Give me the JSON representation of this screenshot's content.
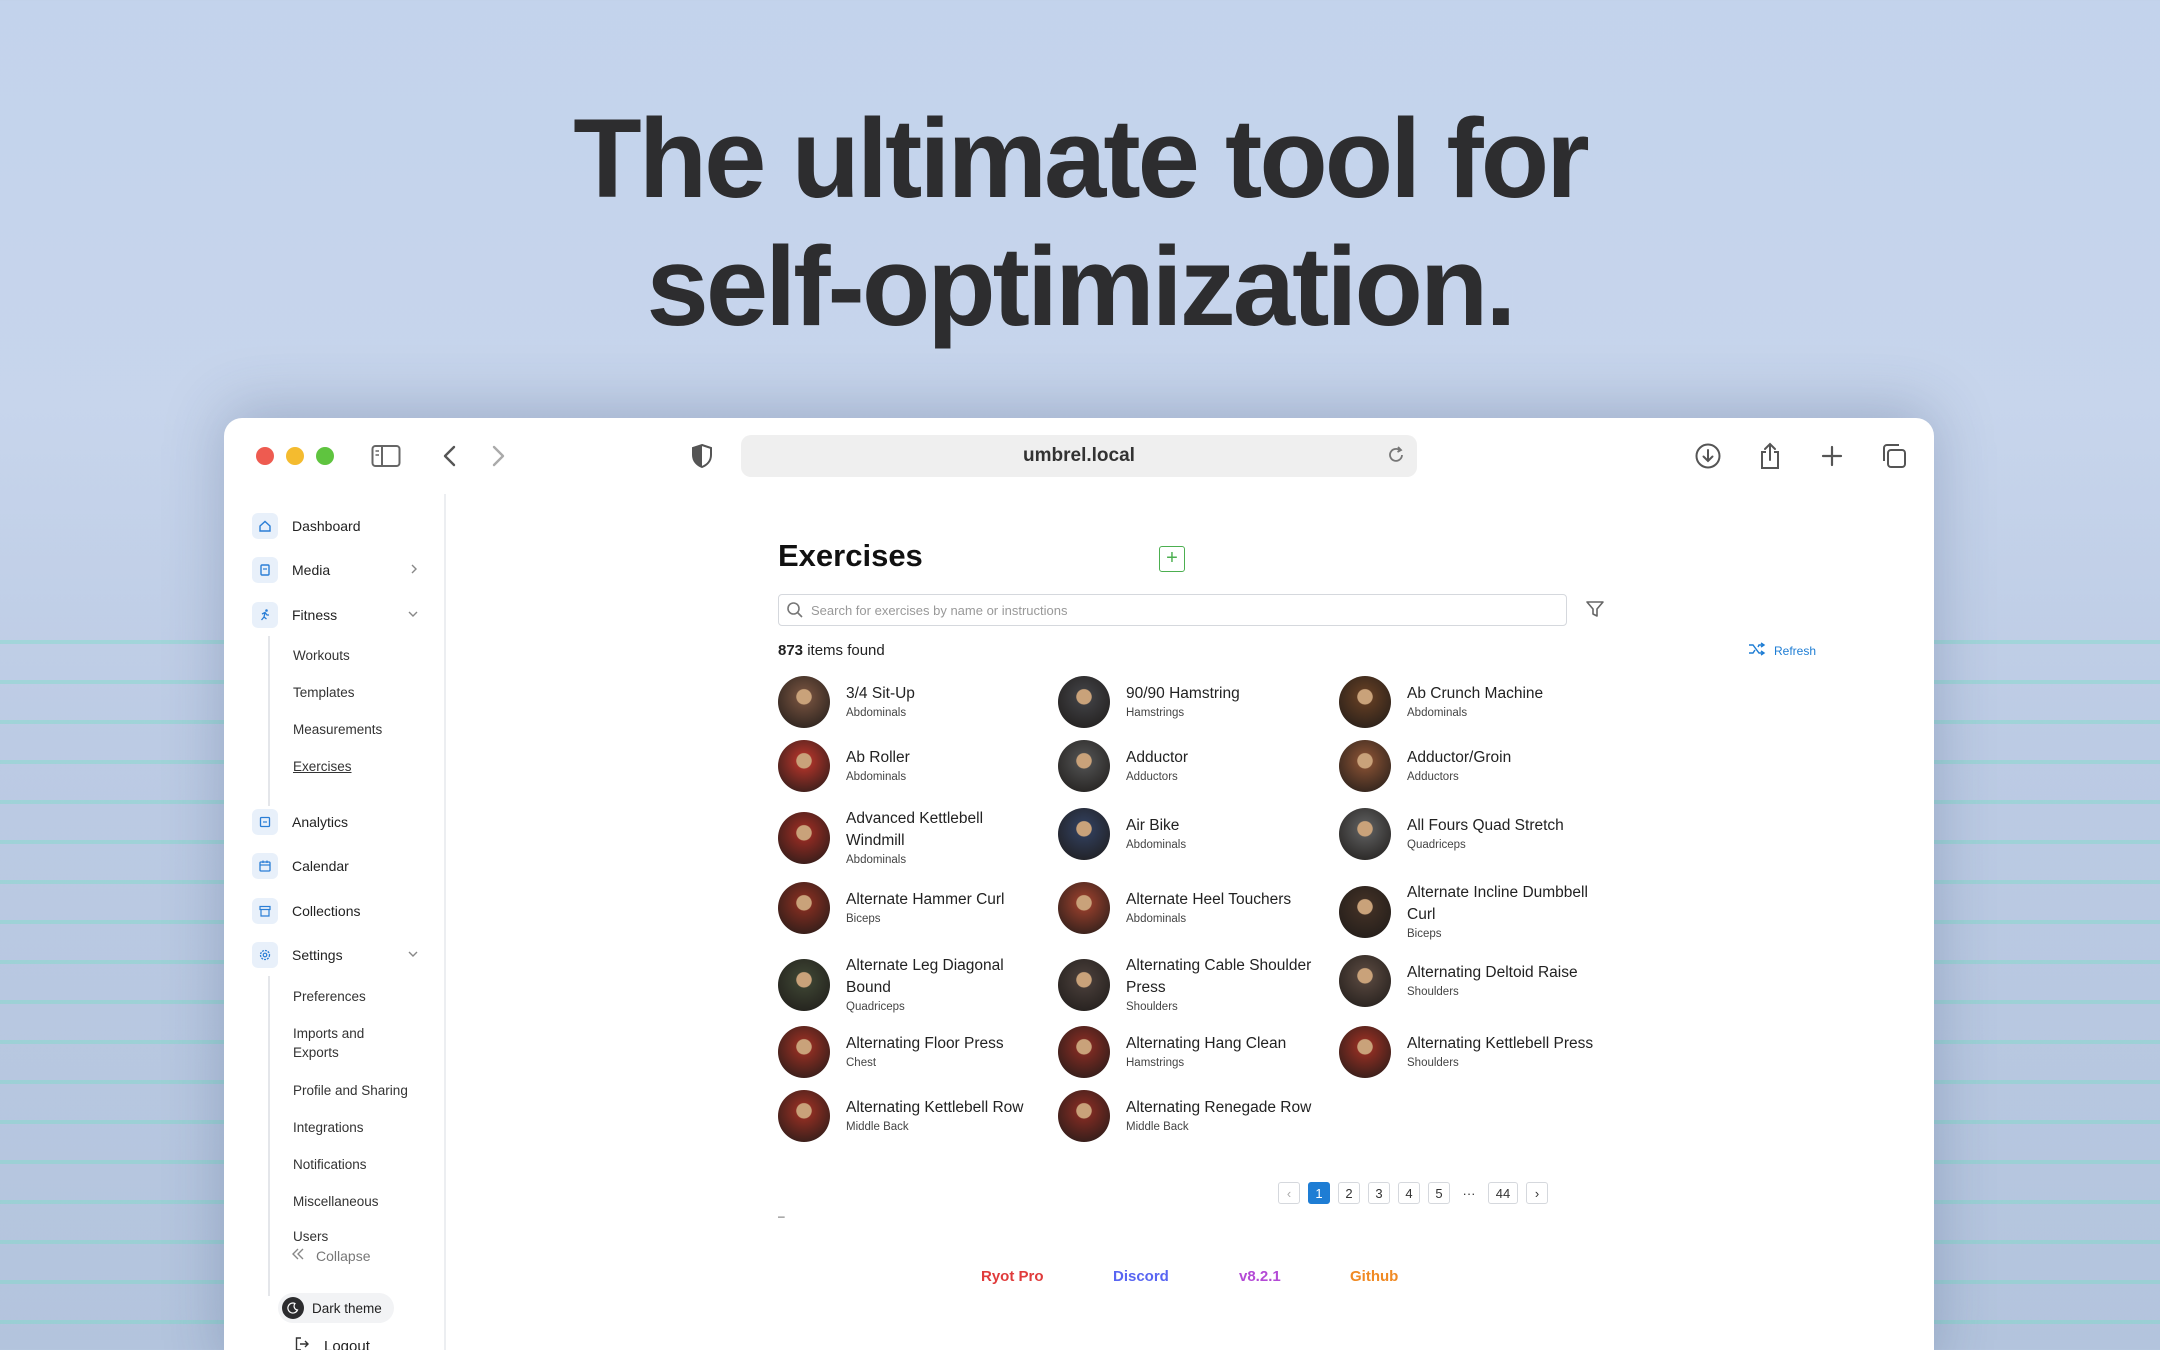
{
  "hero": {
    "line1": "The ultimate tool for",
    "line2": "self-optimization."
  },
  "browser": {
    "url": "umbrel.local",
    "icons": [
      "sidebar-toggle-icon",
      "back-icon",
      "forward-icon",
      "shield-icon",
      "reload-icon",
      "download-icon",
      "share-icon",
      "new-tab-icon",
      "tabs-icon"
    ]
  },
  "sidebar": {
    "items": [
      {
        "label": "Dashboard",
        "icon": "home-icon"
      },
      {
        "label": "Media",
        "icon": "media-icon"
      },
      {
        "label": "Fitness",
        "icon": "run-icon"
      },
      {
        "label": "Analytics",
        "icon": "analytics-icon"
      },
      {
        "label": "Calendar",
        "icon": "calendar-icon"
      },
      {
        "label": "Collections",
        "icon": "collections-icon"
      },
      {
        "label": "Settings",
        "icon": "settings-icon"
      }
    ],
    "fitness_sub": [
      "Workouts",
      "Templates",
      "Measurements",
      "Exercises"
    ],
    "settings_sub": [
      "Preferences",
      "Imports and",
      "Exports",
      "Profile and Sharing",
      "Integrations",
      "Notifications",
      "Miscellaneous",
      "Users"
    ],
    "collapse": "Collapse",
    "dark_theme": "Dark theme",
    "logout": "Logout"
  },
  "main": {
    "title": "Exercises",
    "add": "+",
    "search_placeholder": "Search for exercises by name or instructions",
    "count": "873",
    "count_suffix": " items found",
    "refresh": "Refresh",
    "exercises": [
      {
        "name": "3/4 Sit-Up",
        "name2": "",
        "muscle": "Abdominals"
      },
      {
        "name": "90/90 Hamstring",
        "name2": "",
        "muscle": "Hamstrings"
      },
      {
        "name": "Ab Crunch Machine",
        "name2": "",
        "muscle": "Abdominals"
      },
      {
        "name": "Ab Roller",
        "name2": "",
        "muscle": "Abdominals"
      },
      {
        "name": "Adductor",
        "name2": "",
        "muscle": "Adductors"
      },
      {
        "name": "Adductor/Groin",
        "name2": "",
        "muscle": "Adductors"
      },
      {
        "name": "Advanced Kettlebell",
        "name2": "Windmill",
        "muscle": "Abdominals"
      },
      {
        "name": "Air Bike",
        "name2": "",
        "muscle": "Abdominals"
      },
      {
        "name": "All Fours Quad Stretch",
        "name2": "",
        "muscle": "Quadriceps"
      },
      {
        "name": "Alternate Hammer Curl",
        "name2": "",
        "muscle": "Biceps"
      },
      {
        "name": "Alternate Heel Touchers",
        "name2": "",
        "muscle": "Abdominals"
      },
      {
        "name": "Alternate Incline Dumbbell",
        "name2": "Curl",
        "muscle": "Biceps"
      },
      {
        "name": "Alternate Leg Diagonal",
        "name2": "Bound",
        "muscle": "Quadriceps"
      },
      {
        "name": "Alternating Cable Shoulder",
        "name2": "Press",
        "muscle": "Shoulders"
      },
      {
        "name": "Alternating Deltoid Raise",
        "name2": "",
        "muscle": "Shoulders"
      },
      {
        "name": "Alternating Floor Press",
        "name2": "",
        "muscle": "Chest"
      },
      {
        "name": "Alternating Hang Clean",
        "name2": "",
        "muscle": "Hamstrings"
      },
      {
        "name": "Alternating Kettlebell Press",
        "name2": "",
        "muscle": "Shoulders"
      },
      {
        "name": "Alternating Kettlebell Row",
        "name2": "",
        "muscle": "Middle Back"
      },
      {
        "name": "Alternating Renegade Row",
        "name2": "",
        "muscle": "Middle Back"
      }
    ],
    "pager": {
      "prev": "‹",
      "pages": [
        "1",
        "2",
        "3",
        "4",
        "5"
      ],
      "ellipsis": "···",
      "last": "44",
      "next": "›",
      "current": 1
    },
    "dash": "–"
  },
  "footer": {
    "ryot": "Ryot Pro",
    "discord": "Discord",
    "version": "v8.2.1",
    "github": "Github"
  },
  "colors": {
    "accent": "#1e7dd4",
    "ryot": "#e03b3b",
    "discord": "#5865f2",
    "version": "#b44ad6",
    "github": "#f08a24",
    "add": "#4caf50"
  }
}
